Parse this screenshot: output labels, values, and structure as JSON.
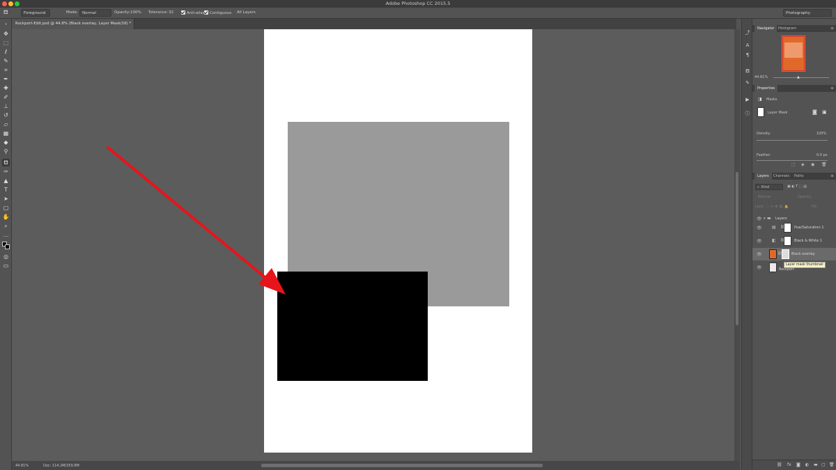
{
  "app": {
    "title": "Adobe Photoshop CC 2015.5"
  },
  "options_bar": {
    "preset": "Foreground",
    "mode_label": "Mode:",
    "mode_value": "Normal",
    "opacity_label": "Opacity:",
    "opacity_value": "100%",
    "tolerance_label": "Tolerance:",
    "tolerance_value": "32",
    "anti_alias": "Anti-alias",
    "contiguous": "Contiguous",
    "all_layers": "All Layers",
    "workspace": "Photography"
  },
  "document_tab": {
    "label": "Rockport-Edit.psd @ 44.8% (Black overlay, Layer Mask/16) *"
  },
  "status_bar": {
    "zoom": "44.81%",
    "doc_size": "Doc: 114.2M/259.8M"
  },
  "navigator": {
    "tabs": [
      "Navigator",
      "Histogram"
    ],
    "zoom": "44.81%"
  },
  "properties": {
    "title": "Properties",
    "section": "Masks",
    "mask_label": "Layer Mask",
    "density_label": "Density:",
    "density_value": "100%",
    "feather_label": "Feather:",
    "feather_value": "0.0 px"
  },
  "layers_panel": {
    "tabs": [
      "Layers",
      "Channels",
      "Paths"
    ],
    "filter_kind": "Kind",
    "blend_mode": "Normal",
    "opacity_label": "Opacity:",
    "lock_label": "Lock:",
    "fill_label": "Fill:",
    "group_name": "Layers",
    "layers": [
      "Hue/Saturation 1",
      "Black & White 1",
      "Black overlay",
      "Rockport"
    ],
    "tooltip": "Layer mask thumbnail"
  },
  "colors": {
    "accent_orange": "#e0692a",
    "arrow_red": "#e8141b"
  }
}
